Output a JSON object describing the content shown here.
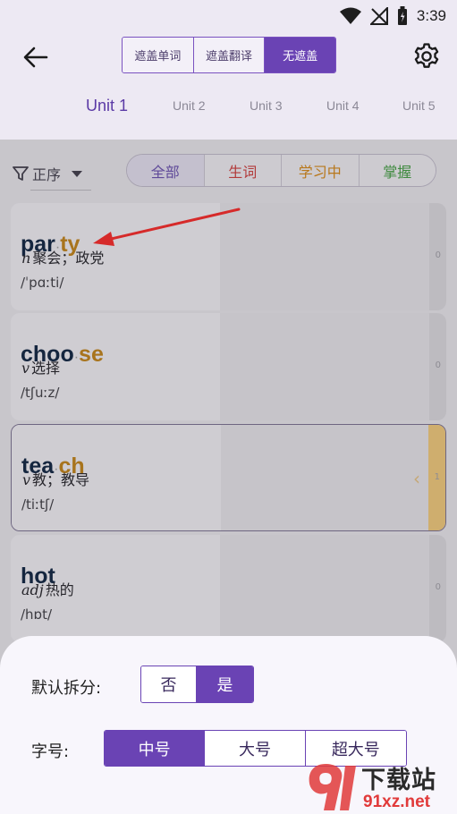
{
  "status_bar": {
    "time": "3:39"
  },
  "mask_modes": {
    "items": [
      "遮盖单词",
      "遮盖翻译",
      "无遮盖"
    ],
    "active_index": 2
  },
  "units": {
    "items": [
      "Unit 1",
      "Unit 2",
      "Unit 3",
      "Unit 4",
      "Unit 5"
    ],
    "active_index": 0
  },
  "filter": {
    "sort_label": "正序"
  },
  "status_filter": {
    "items": [
      "全部",
      "生词",
      "学习中",
      "掌握"
    ],
    "colors": [
      "#5f4a99",
      "#b23a3a",
      "#b8781c",
      "#3f8a3f"
    ],
    "active_index": 0
  },
  "words": [
    {
      "part1": "par",
      "part2": "ty",
      "phonetic": "/ˈpɑːti/",
      "pos": "n",
      "meaning": "聚会；政党",
      "count": "0"
    },
    {
      "part1": "choo",
      "part2": "se",
      "phonetic": "/tʃuːz/",
      "pos": "v",
      "meaning": "选择",
      "count": "0"
    },
    {
      "part1": "tea",
      "part2": "ch",
      "phonetic": "/tiːtʃ/",
      "pos": "v",
      "meaning": "教；教导",
      "count": "1",
      "selected": true
    },
    {
      "part1": "hot",
      "part2": "",
      "phonetic": "/hɒt/",
      "pos": "adj",
      "meaning": "热的",
      "count": "0"
    }
  ],
  "sheet": {
    "split_label": "默认拆分:",
    "split_options": [
      "否",
      "是"
    ],
    "split_active": 1,
    "font_label": "字号:",
    "font_options": [
      "中号",
      "大号",
      "超大号"
    ],
    "font_active": 0
  },
  "watermark": {
    "text": "下载站",
    "url": "91xz.net"
  },
  "colors": {
    "accent": "#6a43b4",
    "arrow": "#d62a2a"
  }
}
